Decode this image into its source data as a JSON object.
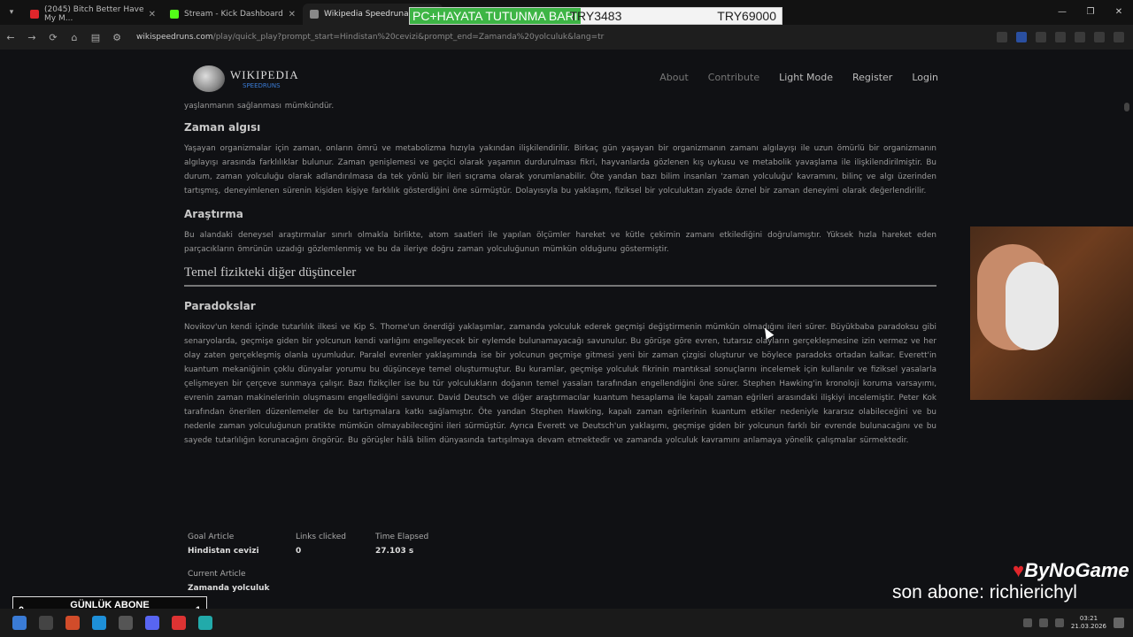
{
  "browser": {
    "tabs": [
      {
        "label": "(2045) Bitch Better Have My M...",
        "favicon_color": "#e0262b"
      },
      {
        "label": "Stream - Kick Dashboard",
        "favicon_color": "#53fc18"
      },
      {
        "label": "Wikipedia Speedrunad",
        "favicon_color": "#888888"
      }
    ],
    "url_domain": "wikispeedruns.com",
    "url_rest": "/play/quick_play?prompt_start=Hindistan%20cevizi&prompt_end=Zamanda%20yolculuk&lang=tr"
  },
  "overlay_banner": {
    "left": "PC+HAYATA TUTUNMA BARI",
    "middle": "TRY3483",
    "right": "TRY69000"
  },
  "wiki": {
    "logo_title": "WIKIPEDIA",
    "logo_sub": "SPEEDRUNS",
    "nav": [
      "About",
      "Contribute",
      "Light Mode",
      "Register",
      "Login"
    ]
  },
  "article": {
    "top_fragment": "yaşlanmanın sağlanması mümkündür.",
    "sections": [
      {
        "heading": "Zaman algısı",
        "text": "Yaşayan organizmalar için zaman, onların ömrü ve metabolizma hızıyla yakından ilişkilendirilir. Birkaç gün yaşayan bir organizmanın zamanı algılayışı ile uzun ömürlü bir organizmanın algılayışı arasında farklılıklar bulunur. Zaman genişlemesi ve geçici olarak yaşamın durdurulması fikri, hayvanlarda gözlenen kış uykusu ve metabolik yavaşlama ile ilişkilendirilmiştir. Bu durum, zaman yolculuğu olarak adlandırılmasa da tek yönlü bir ileri sıçrama olarak yorumlanabilir. Öte yandan bazı bilim insanları 'zaman yolculuğu' kavramını, bilinç ve algı üzerinden tartışmış, deneyimlenen sürenin kişiden kişiye farklılık gösterdiğini öne sürmüştür. Dolayısıyla bu yaklaşım, fiziksel bir yolculuktan ziyade öznel bir zaman deneyimi olarak değerlendirilir."
      },
      {
        "heading": "Araştırma",
        "text": "Bu alandaki deneysel araştırmalar sınırlı olmakla birlikte, atom saatleri ile yapılan ölçümler hareket ve kütle çekimin zamanı etkilediğini doğrulamıştır. Yüksek hızla hareket eden parçacıkların ömrünün uzadığı gözlemlenmiş ve bu da ileriye doğru zaman yolculuğunun mümkün olduğunu göstermiştir."
      }
    ],
    "major_heading": "Temel fizikteki diğer düşünceler",
    "subsections": [
      {
        "heading": "Paradokslar",
        "text": "Novikov'un kendi içinde tutarlılık ilkesi ve Kip S. Thorne'un önerdiği yaklaşımlar, zamanda yolculuk ederek geçmişi değiştirmenin mümkün olmadığını ileri sürer. Büyükbaba paradoksu gibi senaryolarda, geçmişe giden bir yolcunun kendi varlığını engelleyecek bir eylemde bulunamayacağı savunulur. Bu görüşe göre evren, tutarsız olayların gerçekleşmesine izin vermez ve her olay zaten gerçekleşmiş olanla uyumludur. Paralel evrenler yaklaşımında ise bir yolcunun geçmişe gitmesi yeni bir zaman çizgisi oluşturur ve böylece paradoks ortadan kalkar. Everett'in kuantum mekaniğinin çoklu dünyalar yorumu bu düşünceye temel oluşturmuştur. Bu kuramlar, geçmişe yolculuk fikrinin mantıksal sonuçlarını incelemek için kullanılır ve fiziksel yasalarla çelişmeyen bir çerçeve sunmaya çalışır. Bazı fizikçiler ise bu tür yolculukların doğanın temel yasaları tarafından engellendiğini öne sürer. Stephen Hawking'in kronoloji koruma varsayımı, evrenin zaman makinelerinin oluşmasını engellediğini savunur. David Deutsch ve diğer araştırmacılar kuantum hesaplama ile kapalı zaman eğrileri arasındaki ilişkiyi incelemiştir. Peter Kok tarafından önerilen düzenlemeler de bu tartışmalara katkı sağlamıştır. Öte yandan Stephen Hawking, kapalı zaman eğrilerinin kuantum etkiler nedeniyle kararsız olabileceğini ve bu nedenle zaman yolculuğunun pratikte mümkün olmayabileceğini ileri sürmüştür. Ayrıca Everett ve Deutsch'un yaklaşımı, geçmişe giden bir yolcunun farklı bir evrende bulunacağını ve bu sayede tutarlılığın korunacağını öngörür. Bu görüşler hâlâ bilim dünyasında tartışılmaya devam etmektedir ve zamanda yolculuk kavramını anlamaya yönelik çalışmalar sürmektedir."
      }
    ]
  },
  "game": {
    "goal_label": "Goal Article",
    "goal_value": "Hindistan cevizi",
    "links_label": "Links clicked",
    "links_value": "0",
    "time_label": "Time Elapsed",
    "time_value": "27.103 s",
    "current_label": "Current Article",
    "current_value": "Zamanda yolculuk"
  },
  "stream_overlay": {
    "brand": "ByNoGame",
    "last_sub": "son abone: richierichyl",
    "goal_title": "GÜNLÜK ABONE HEDEFİ",
    "goal_current": "0",
    "goal_target": "1"
  },
  "taskbar": {
    "time": "03:21",
    "date": "21.03.2026"
  }
}
